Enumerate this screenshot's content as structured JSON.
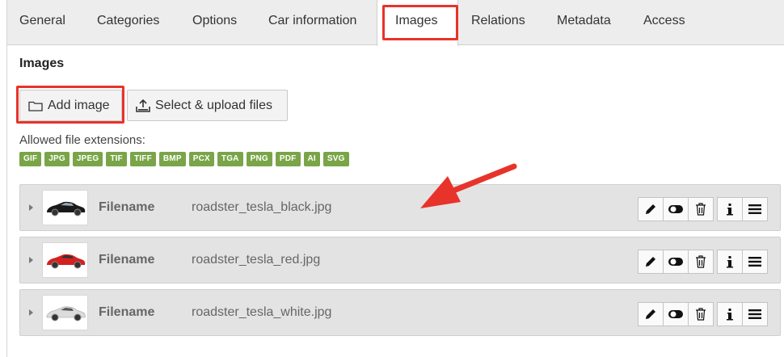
{
  "tabs": [
    {
      "label": "General"
    },
    {
      "label": "Categories"
    },
    {
      "label": "Options"
    },
    {
      "label": "Car information"
    },
    {
      "label": "Images"
    },
    {
      "label": "Relations"
    },
    {
      "label": "Metadata"
    },
    {
      "label": "Access"
    }
  ],
  "active_tab": "Images",
  "section": {
    "title": "Images"
  },
  "buttons": {
    "add_image": "Add image",
    "select_upload": "Select & upload files"
  },
  "allowed": {
    "label": "Allowed file extensions:",
    "extensions": [
      "GIF",
      "JPG",
      "JPEG",
      "TIF",
      "TIFF",
      "BMP",
      "PCX",
      "TGA",
      "PNG",
      "PDF",
      "AI",
      "SVG"
    ]
  },
  "files": [
    {
      "label": "Filename",
      "value": "roadster_tesla_black.jpg",
      "car_color": "#1a1a1a"
    },
    {
      "label": "Filename",
      "value": "roadster_tesla_red.jpg",
      "car_color": "#d42020"
    },
    {
      "label": "Filename",
      "value": "roadster_tesla_white.jpg",
      "car_color": "#dcdcdc"
    }
  ],
  "row_actions": [
    "edit-icon",
    "toggle-icon",
    "delete-icon",
    "info-icon",
    "drag-handle-icon"
  ],
  "colors": {
    "highlight": "#e8332a",
    "extension_badge": "#79a548",
    "arrow": "#e8332a"
  }
}
